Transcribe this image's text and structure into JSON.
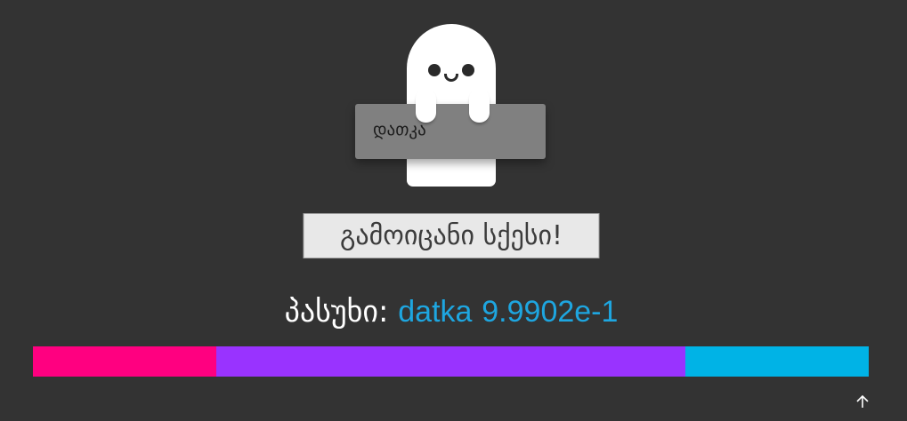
{
  "theme": {
    "background": "#333333",
    "accent": "#1ea6e0"
  },
  "mascot": {
    "icon": "ghost-icon",
    "color": "#ffffff"
  },
  "name_input": {
    "value": "დათკა"
  },
  "guess_button": {
    "label": "გამოიცანი სქესი!"
  },
  "result": {
    "label": "პასუხი:",
    "name": "datka",
    "score": "9.9902e-1",
    "color": "#1ea6e0"
  },
  "result_bar": {
    "segments": [
      {
        "color": "#ff0080"
      },
      {
        "color": "#9933ff"
      },
      {
        "color": "#00b3e6"
      }
    ]
  },
  "scroll_top": {
    "icon": "arrow-up-icon"
  }
}
